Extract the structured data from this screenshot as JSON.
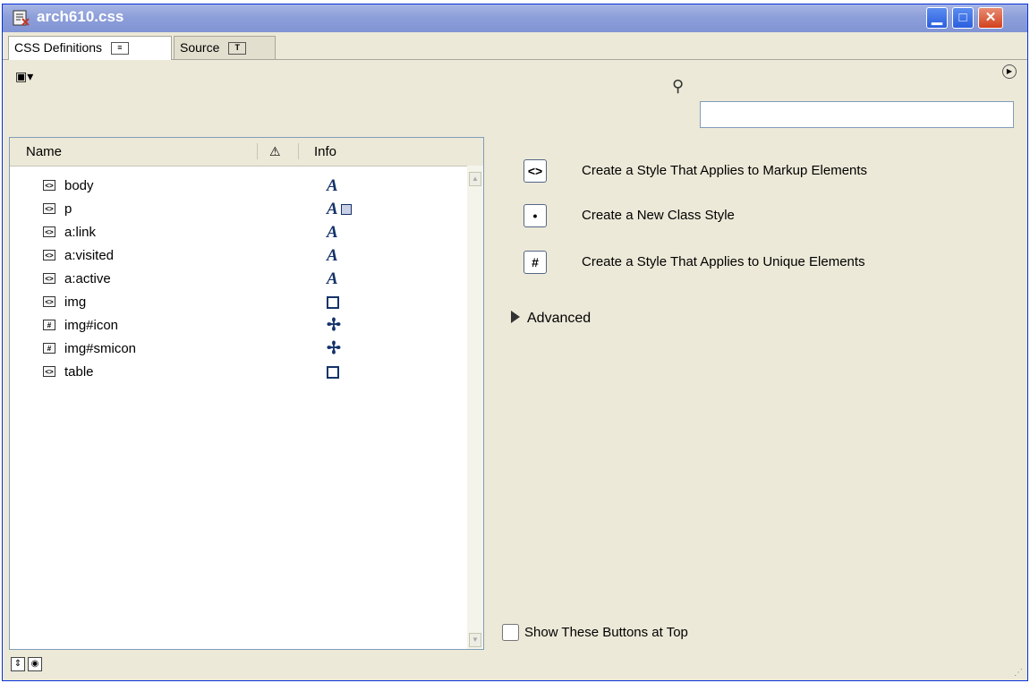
{
  "window": {
    "title": "arch610.css"
  },
  "tabs": [
    {
      "label": "CSS Definitions",
      "icon": "list-view-icon",
      "active": true
    },
    {
      "label": "Source",
      "icon": "text-view-icon",
      "active": false
    }
  ],
  "search": {
    "placeholder": "",
    "value": ""
  },
  "list": {
    "columns": {
      "name": "Name",
      "info": "Info"
    },
    "rules": [
      {
        "name": "body",
        "type": "element",
        "info": "A"
      },
      {
        "name": "p",
        "type": "element",
        "info": "A"
      },
      {
        "name": "a:link",
        "type": "element",
        "info": "A"
      },
      {
        "name": "a:visited",
        "type": "element",
        "info": "A"
      },
      {
        "name": "a:active",
        "type": "element",
        "info": "A"
      },
      {
        "name": "img",
        "type": "element",
        "info": "box-icon"
      },
      {
        "name": "img#icon",
        "type": "id",
        "info": "move-icon"
      },
      {
        "name": "img#smicon",
        "type": "id",
        "info": "move-icon"
      },
      {
        "name": "table",
        "type": "element",
        "info": "box-icon"
      }
    ]
  },
  "actions": [
    {
      "icon": "<>",
      "label": "Create a Style That Applies to Markup Elements"
    },
    {
      "icon": "•",
      "label": "Create a New Class Style"
    },
    {
      "icon": "#",
      "label": "Create a Style That Applies to Unique Elements"
    }
  ],
  "advanced": {
    "label": "Advanced"
  },
  "options": {
    "show_buttons_top_label": "Show These Buttons at Top",
    "show_buttons_top_checked": false
  },
  "colors": {
    "titlebar": "#8d9fd9",
    "panel_bg": "#ece9d8",
    "info_icon": "#14336a",
    "border": "#7f9db9"
  }
}
